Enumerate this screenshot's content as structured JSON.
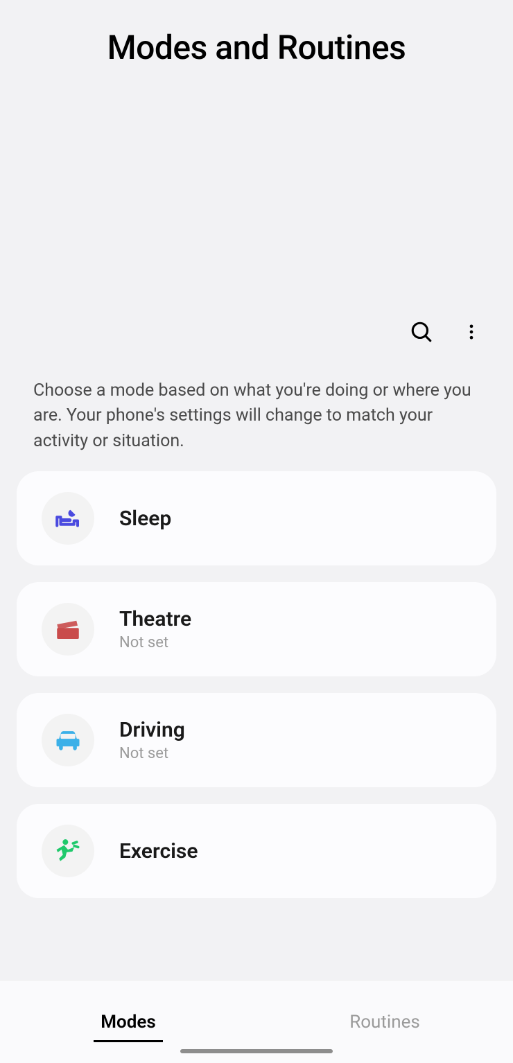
{
  "title": "Modes and Routines",
  "description": "Choose a mode based on what you're doing or where you are. Your phone's settings will change to match your activity or situation.",
  "modes": [
    {
      "label": "Sleep",
      "sub": null
    },
    {
      "label": "Theatre",
      "sub": "Not set"
    },
    {
      "label": "Driving",
      "sub": "Not set"
    },
    {
      "label": "Exercise",
      "sub": null
    }
  ],
  "nav": {
    "active": "Modes",
    "inactive": "Routines"
  }
}
